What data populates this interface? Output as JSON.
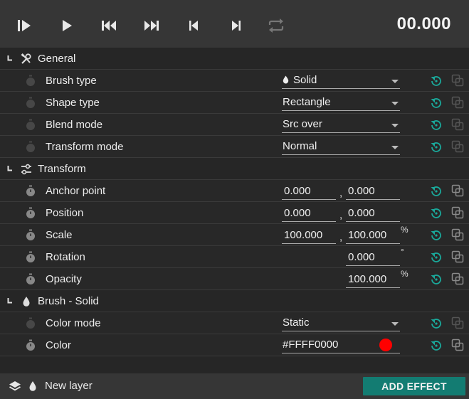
{
  "toolbar": {
    "time": "00.000",
    "buttons": [
      "play-from-start",
      "play",
      "skip-back",
      "skip-forward",
      "previous-frame",
      "next-frame",
      "loop"
    ]
  },
  "sections": {
    "general": {
      "label": "General",
      "icon": "tools-icon"
    },
    "transform": {
      "label": "Transform",
      "icon": "sliders-icon"
    },
    "brush": {
      "label": "Brush - Solid",
      "icon": "drop-icon"
    }
  },
  "general": {
    "brush_type": {
      "label": "Brush type",
      "value": "Solid"
    },
    "shape_type": {
      "label": "Shape type",
      "value": "Rectangle"
    },
    "blend_mode": {
      "label": "Blend mode",
      "value": "Src over"
    },
    "transform_mode": {
      "label": "Transform mode",
      "value": "Normal"
    }
  },
  "transform": {
    "anchor_point": {
      "label": "Anchor point",
      "x": "0.000",
      "y": "0.000"
    },
    "position": {
      "label": "Position",
      "x": "0.000",
      "y": "0.000"
    },
    "scale": {
      "label": "Scale",
      "x": "100.000",
      "y": "100.000",
      "unit": "%"
    },
    "rotation": {
      "label": "Rotation",
      "value": "0.000",
      "unit": "°"
    },
    "opacity": {
      "label": "Opacity",
      "value": "100.000",
      "unit": "%"
    }
  },
  "brush": {
    "color_mode": {
      "label": "Color mode",
      "value": "Static"
    },
    "color": {
      "label": "Color",
      "value": "#FFFF0000",
      "swatch": "#ff0000"
    }
  },
  "footer": {
    "layer_name": "New layer",
    "add_effect_label": "ADD EFFECT"
  },
  "colors": {
    "accent": "#137c72",
    "reset_icon": "#1aa89a",
    "toolbar_bg": "#363636"
  }
}
